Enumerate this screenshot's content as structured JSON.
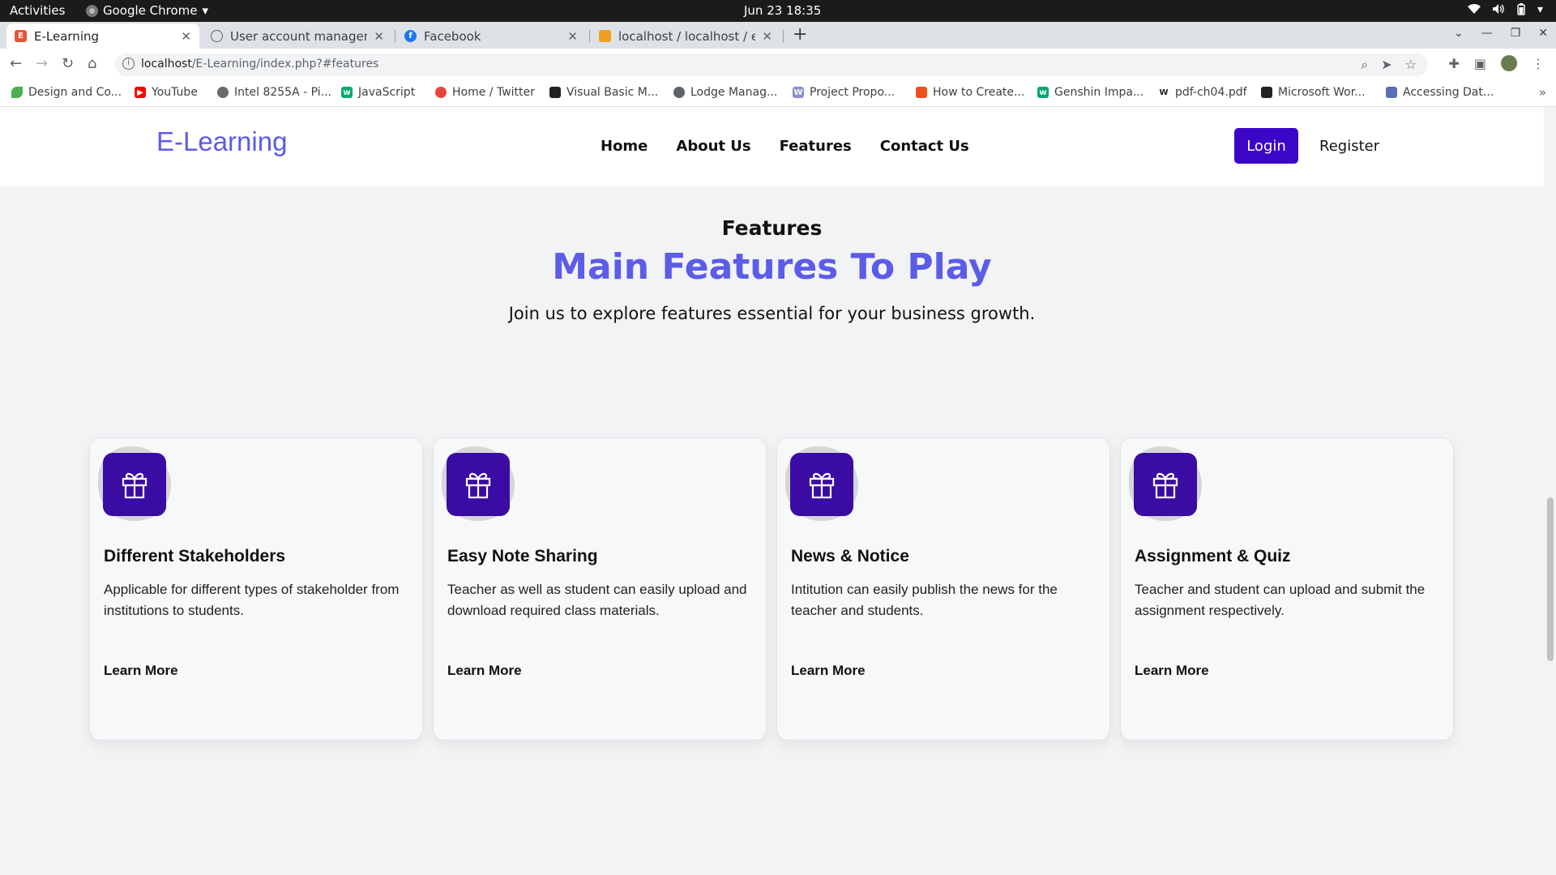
{
  "os": {
    "activities": "Activities",
    "app_name": "Google Chrome",
    "clock": "Jun 23  18:35"
  },
  "tabs": [
    {
      "title": "E-Learning",
      "icon": "elearning-favicon",
      "active": true
    },
    {
      "title": "User account managemer",
      "icon": "globe-icon",
      "active": false
    },
    {
      "title": "Facebook",
      "icon": "facebook-icon",
      "active": false
    },
    {
      "title": "localhost / localhost / ele",
      "icon": "phpmyadmin-icon",
      "active": false
    }
  ],
  "address": {
    "host": "localhost",
    "path": "/E-Learning/index.php?#features"
  },
  "bookmarks": [
    {
      "label": "Design and Co...",
      "icon": "leaf-icon",
      "color": "#4caf50"
    },
    {
      "label": "YouTube",
      "icon": "youtube-icon",
      "color": "#ff0000"
    },
    {
      "label": "Intel 8255A - Pi...",
      "icon": "gear-icon",
      "color": "#6b6b6b"
    },
    {
      "label": "JavaScript",
      "icon": "w3-icon",
      "color": "#04aa6d"
    },
    {
      "label": "Home / Twitter",
      "icon": "twitter-icon",
      "color": "#e8453c"
    },
    {
      "label": "Visual Basic M...",
      "icon": "book-icon",
      "color": "#222222"
    },
    {
      "label": "Lodge Manag...",
      "icon": "globe-icon",
      "color": "#5f6368"
    },
    {
      "label": "Project Propo...",
      "icon": "w-icon",
      "color": "#8a8fcc"
    },
    {
      "label": "How to Create...",
      "icon": "figma-icon",
      "color": "#f24e1e"
    },
    {
      "label": "Genshin Impa...",
      "icon": "w3-icon",
      "color": "#04aa6d"
    },
    {
      "label": "pdf-ch04.pdf",
      "icon": "wiki-icon",
      "color": "#222222"
    },
    {
      "label": "Microsoft Wor...",
      "icon": "book-icon",
      "color": "#222222"
    },
    {
      "label": "Accessing Dat...",
      "icon": "doc-icon",
      "color": "#5b6fb8"
    }
  ],
  "site": {
    "brand": "E-Learning",
    "nav": [
      "Home",
      "About Us",
      "Features",
      "Contact Us"
    ],
    "login": "Login",
    "register": "Register",
    "accent": "#5b5ce8",
    "button_color": "#3b06c8"
  },
  "features": {
    "eyebrow": "Features",
    "title": "Main Features To Play",
    "subtitle": "Join us to explore features essential for your business growth.",
    "cards": [
      {
        "title": "Different Stakeholders",
        "text": "Applicable for different types of stakeholder from institutions to students.",
        "link": "Learn More",
        "icon": "gift-icon"
      },
      {
        "title": "Easy Note Sharing",
        "text": "Teacher as well as student can easily upload and download required class materials.",
        "link": "Learn More",
        "icon": "gift-icon"
      },
      {
        "title": "News & Notice",
        "text": "Intitution can easily publish the news for the teacher and students.",
        "link": "Learn More",
        "icon": "gift-icon"
      },
      {
        "title": "Assignment & Quiz",
        "text": "Teacher and student can upload and submit the assignment respectively.",
        "link": "Learn More",
        "icon": "gift-icon"
      }
    ]
  }
}
